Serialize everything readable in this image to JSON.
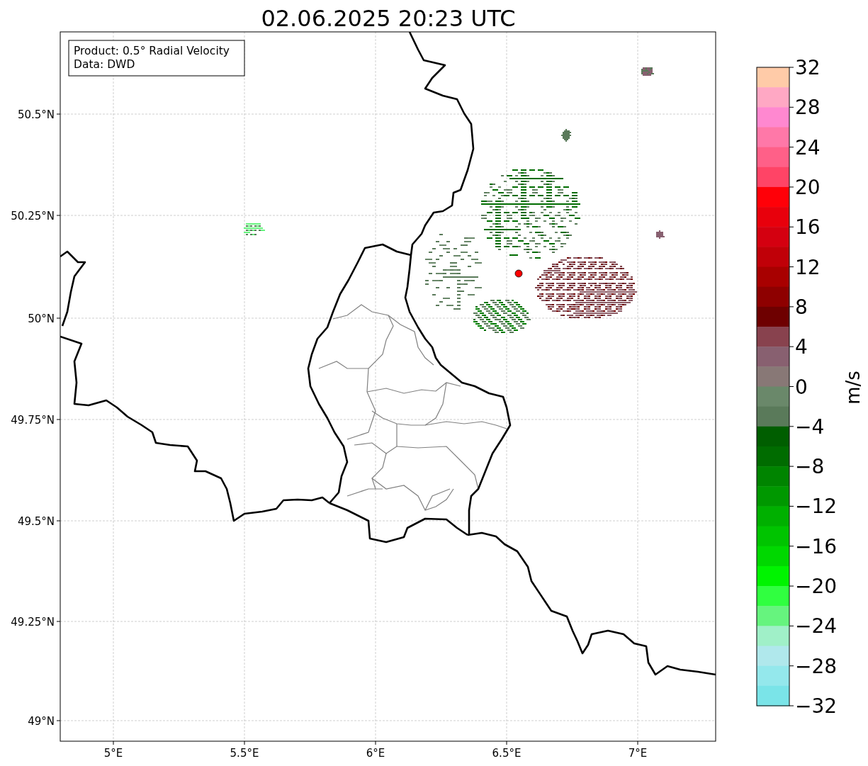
{
  "title": "02.06.2025 20:23 UTC",
  "info_box": [
    "Product: 0.5° Radial Velocity",
    "Data: DWD"
  ],
  "lat_ticks": [
    "50.5°N",
    "50.25°N",
    "50°N",
    "49.75°N",
    "49.5°N",
    "49.25°N",
    "49°N"
  ],
  "lon_ticks": [
    "5°E",
    "5.5°E",
    "6°E",
    "6.5°E",
    "7°E"
  ],
  "colorbar": {
    "label": "m/s",
    "ticks": [
      "32",
      "28",
      "24",
      "20",
      "16",
      "12",
      "8",
      "4",
      "0",
      "−4",
      "−8",
      "−12",
      "−16",
      "−20",
      "−24",
      "−28",
      "−32"
    ],
    "segments": [
      {
        "color": "#ffcba8"
      },
      {
        "color": "#ffa8c4"
      },
      {
        "color": "#ff88d0"
      },
      {
        "color": "#ff78a8"
      },
      {
        "color": "#ff6088"
      },
      {
        "color": "#ff4466"
      },
      {
        "color": "#ff0008"
      },
      {
        "color": "#e8000c"
      },
      {
        "color": "#d40010"
      },
      {
        "color": "#c00008"
      },
      {
        "color": "#a80000"
      },
      {
        "color": "#8e0000"
      },
      {
        "color": "#6e0000"
      },
      {
        "color": "#88424e"
      },
      {
        "color": "#886070"
      },
      {
        "color": "#887876"
      },
      {
        "color": "#6a886a"
      },
      {
        "color": "#5a7a5a"
      },
      {
        "color": "#005e00"
      },
      {
        "color": "#006c00"
      },
      {
        "color": "#008400"
      },
      {
        "color": "#009800"
      },
      {
        "color": "#00b000"
      },
      {
        "color": "#00c400"
      },
      {
        "color": "#00d800"
      },
      {
        "color": "#00f400"
      },
      {
        "color": "#30ff40"
      },
      {
        "color": "#66f47e"
      },
      {
        "color": "#a0f0c8"
      },
      {
        "color": "#b0e8ec"
      },
      {
        "color": "#94e8ec"
      },
      {
        "color": "#7ae4e8"
      }
    ]
  }
}
